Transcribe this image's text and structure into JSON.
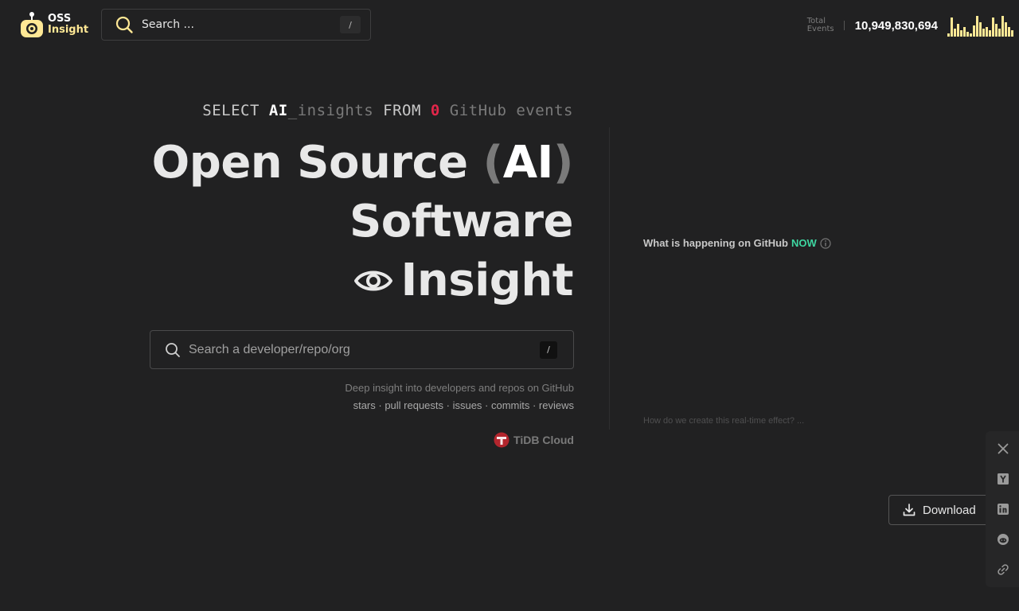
{
  "header": {
    "logo": {
      "line1": "OSS",
      "line2": "Insight"
    },
    "search": {
      "placeholder": "Search ...",
      "shortcut": "/"
    },
    "stats": {
      "label_line1": "Total",
      "label_line2": "Events",
      "count": "10,949,830,694"
    }
  },
  "hero": {
    "sql": {
      "select": "SELECT",
      "ai": "AI",
      "insights": "_insights",
      "from": "FROM",
      "zero": "0",
      "events": "GitHub events"
    },
    "line1": {
      "open_source": "Open Source",
      "open_paren": "(",
      "ai": "AI",
      "close_paren": ")"
    },
    "line2": "Software",
    "line3": "Insight",
    "search": {
      "placeholder": "Search a developer/repo/org",
      "shortcut": "/"
    },
    "tagline1": "Deep insight into developers and repos on GitHub",
    "tagline2": "stars · pull requests · issues · commits · reviews",
    "sponsor": "TiDB Cloud"
  },
  "realtime": {
    "title": "What is happening on GitHub",
    "now": "NOW",
    "link": "How do we create this real-time effect? ..."
  },
  "floating": {
    "download_label": "Download"
  },
  "colors": {
    "background": "#212122",
    "accent_yellow": "#ffe895",
    "accent_green": "#3ed6a1",
    "accent_red": "#e3264a"
  },
  "icons": [
    "search-icon",
    "eye-icon",
    "info-icon",
    "download-icon",
    "x-twitter-icon",
    "hacker-news-icon",
    "linkedin-icon",
    "reddit-icon",
    "link-icon"
  ]
}
